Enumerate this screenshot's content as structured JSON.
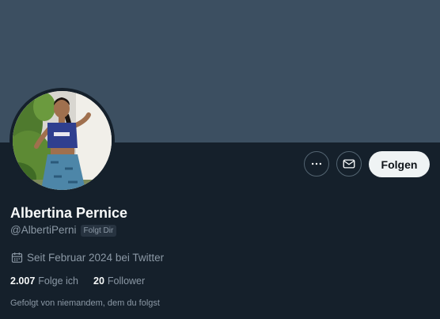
{
  "profile": {
    "display_name": "Albertina Pernice",
    "handle": "@AlbertiPerni",
    "follows_you_badge": "Folgt Dir",
    "joined": "Seit Februar 2024 bei Twitter",
    "following_count": "2.007",
    "following_label": "Folge ich",
    "followers_count": "20",
    "followers_label": "Follower",
    "followed_by": "Gefolgt von niemandem, dem du folgst"
  },
  "actions": {
    "more_icon": "more-horizontal-icon",
    "message_icon": "mail-icon",
    "follow_label": "Folgen"
  },
  "colors": {
    "background": "#15202b",
    "banner": "#3c4f61",
    "primary_text": "#f7f9f9",
    "secondary_text": "#8b98a5",
    "follow_button_bg": "#eff3f4"
  }
}
